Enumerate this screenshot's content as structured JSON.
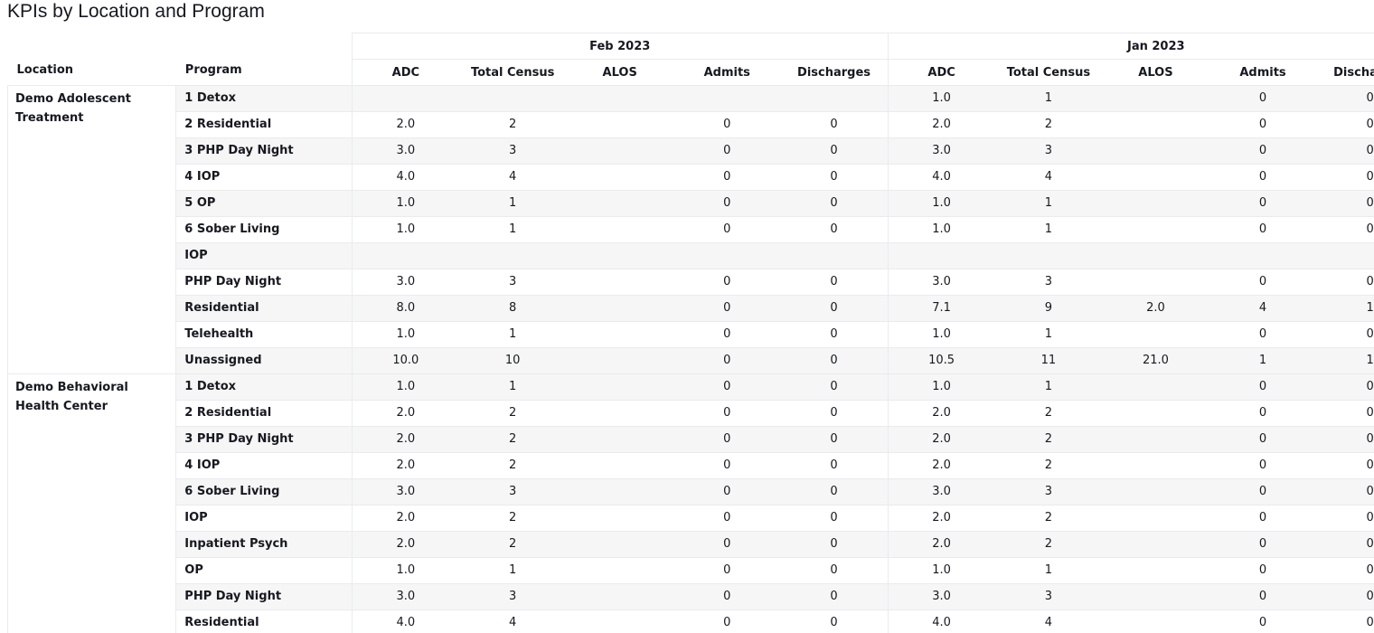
{
  "page": {
    "title": "KPIs by Location and Program"
  },
  "header": {
    "location_label": "Location",
    "program_label": "Program",
    "periods": [
      "Feb 2023",
      "Jan 2023"
    ],
    "metrics": [
      "ADC",
      "Total Census",
      "ALOS",
      "Admits",
      "Discharges"
    ]
  },
  "groups": [
    {
      "location": "Demo Adolescent Treatment",
      "rows": [
        {
          "program": "1 Detox",
          "values": [
            "",
            "",
            "",
            "",
            "",
            "1.0",
            "1",
            "",
            "0",
            "0"
          ]
        },
        {
          "program": "2 Residential",
          "values": [
            "2.0",
            "2",
            "",
            "0",
            "0",
            "2.0",
            "2",
            "",
            "0",
            "0"
          ]
        },
        {
          "program": "3 PHP Day Night",
          "values": [
            "3.0",
            "3",
            "",
            "0",
            "0",
            "3.0",
            "3",
            "",
            "0",
            "0"
          ]
        },
        {
          "program": "4 IOP",
          "values": [
            "4.0",
            "4",
            "",
            "0",
            "0",
            "4.0",
            "4",
            "",
            "0",
            "0"
          ]
        },
        {
          "program": "5 OP",
          "values": [
            "1.0",
            "1",
            "",
            "0",
            "0",
            "1.0",
            "1",
            "",
            "0",
            "0"
          ]
        },
        {
          "program": "6 Sober Living",
          "values": [
            "1.0",
            "1",
            "",
            "0",
            "0",
            "1.0",
            "1",
            "",
            "0",
            "0"
          ]
        },
        {
          "program": "IOP",
          "values": [
            "",
            "",
            "",
            "",
            "",
            "",
            "",
            "",
            "",
            ""
          ]
        },
        {
          "program": "PHP Day Night",
          "values": [
            "3.0",
            "3",
            "",
            "0",
            "0",
            "3.0",
            "3",
            "",
            "0",
            "0"
          ]
        },
        {
          "program": "Residential",
          "values": [
            "8.0",
            "8",
            "",
            "0",
            "0",
            "7.1",
            "9",
            "2.0",
            "4",
            "1"
          ]
        },
        {
          "program": "Telehealth",
          "values": [
            "1.0",
            "1",
            "",
            "0",
            "0",
            "1.0",
            "1",
            "",
            "0",
            "0"
          ]
        },
        {
          "program": "Unassigned",
          "values": [
            "10.0",
            "10",
            "",
            "0",
            "0",
            "10.5",
            "11",
            "21.0",
            "1",
            "1"
          ]
        }
      ]
    },
    {
      "location": "Demo Behavioral Health Center",
      "rows": [
        {
          "program": "1 Detox",
          "values": [
            "1.0",
            "1",
            "",
            "0",
            "0",
            "1.0",
            "1",
            "",
            "0",
            "0"
          ]
        },
        {
          "program": "2 Residential",
          "values": [
            "2.0",
            "2",
            "",
            "0",
            "0",
            "2.0",
            "2",
            "",
            "0",
            "0"
          ]
        },
        {
          "program": "3 PHP Day Night",
          "values": [
            "2.0",
            "2",
            "",
            "0",
            "0",
            "2.0",
            "2",
            "",
            "0",
            "0"
          ]
        },
        {
          "program": "4 IOP",
          "values": [
            "2.0",
            "2",
            "",
            "0",
            "0",
            "2.0",
            "2",
            "",
            "0",
            "0"
          ]
        },
        {
          "program": "6 Sober Living",
          "values": [
            "3.0",
            "3",
            "",
            "0",
            "0",
            "3.0",
            "3",
            "",
            "0",
            "0"
          ]
        },
        {
          "program": "IOP",
          "values": [
            "2.0",
            "2",
            "",
            "0",
            "0",
            "2.0",
            "2",
            "",
            "0",
            "0"
          ]
        },
        {
          "program": "Inpatient Psych",
          "values": [
            "2.0",
            "2",
            "",
            "0",
            "0",
            "2.0",
            "2",
            "",
            "0",
            "0"
          ]
        },
        {
          "program": "OP",
          "values": [
            "1.0",
            "1",
            "",
            "0",
            "0",
            "1.0",
            "1",
            "",
            "0",
            "0"
          ]
        },
        {
          "program": "PHP Day Night",
          "values": [
            "3.0",
            "3",
            "",
            "0",
            "0",
            "3.0",
            "3",
            "",
            "0",
            "0"
          ]
        },
        {
          "program": "Residential",
          "values": [
            "4.0",
            "4",
            "",
            "0",
            "0",
            "4.0",
            "4",
            "",
            "0",
            "0"
          ]
        },
        {
          "program": "",
          "values": [
            "",
            "",
            "",
            "",
            "",
            "",
            "",
            "",
            "",
            ""
          ]
        }
      ]
    }
  ]
}
